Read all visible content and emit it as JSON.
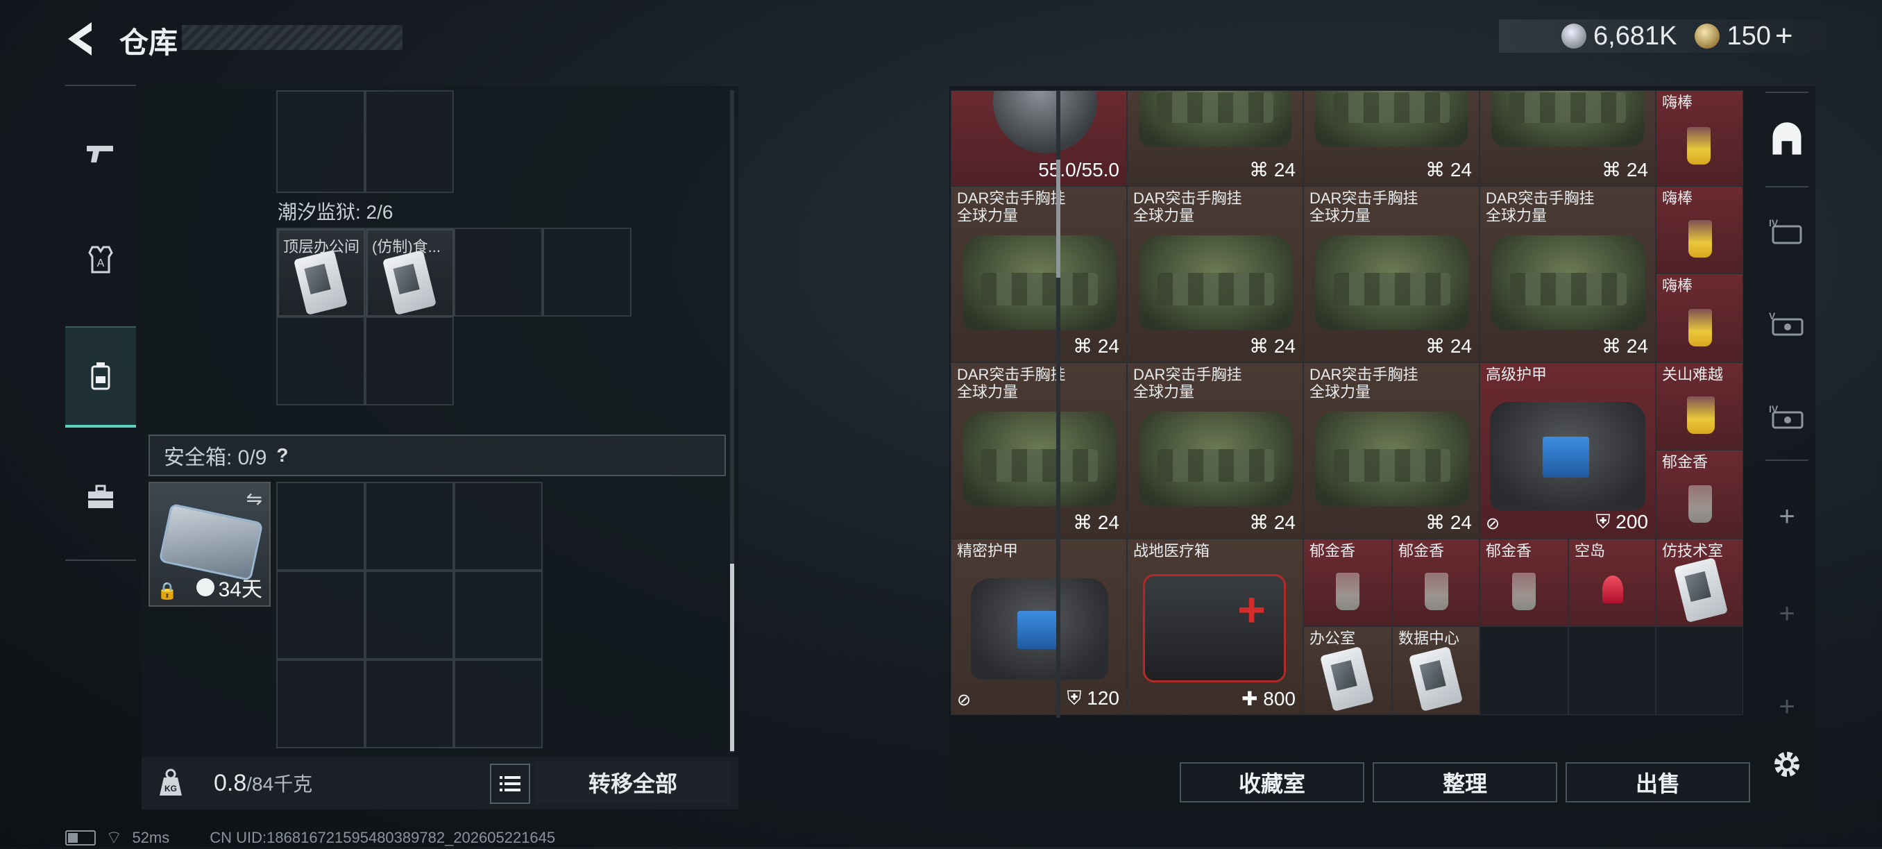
{
  "header": {
    "title": "仓库"
  },
  "currency": {
    "silver": "6,681K",
    "gold": "150"
  },
  "left_nav": [
    {
      "name": "weapons",
      "icon": "pistol-icon"
    },
    {
      "name": "armor",
      "icon": "armor-vest-icon"
    },
    {
      "name": "backpack",
      "icon": "backpack-icon"
    },
    {
      "name": "equipment",
      "icon": "toolbox-icon"
    }
  ],
  "left_panel": {
    "keycard_label": "潮汐监狱: 2/6",
    "keycards": [
      "顶层办公间",
      "(仿制)食..."
    ],
    "safe_box": {
      "label": "安全箱: 0/9",
      "help": "?",
      "duration": "34天"
    },
    "weight": {
      "current": "0.8",
      "max": "/84千克"
    },
    "transfer_all": "转移全部"
  },
  "inventory": {
    "top_row": [
      {
        "value": "55.0/55.0"
      },
      {
        "count": "24"
      },
      {
        "count": "24"
      },
      {
        "count": "24"
      },
      {
        "name": "嗨棒"
      }
    ],
    "rows": [
      {
        "name": "DAR突击手胸挂",
        "sub": "全球力量",
        "count": "24"
      },
      {
        "name": "DAR突击手胸挂",
        "sub": "全球力量",
        "count": "24"
      },
      {
        "name": "DAR突击手胸挂",
        "sub": "全球力量",
        "count": "24"
      },
      {
        "name": "DAR突击手胸挂",
        "sub": "全球力量",
        "count": "24"
      },
      {
        "name": "DAR突击手胸挂",
        "sub": "全球力量",
        "count": "24"
      },
      {
        "name": "DAR突击手胸挂",
        "sub": "全球力量",
        "count": "24"
      },
      {
        "name": "DAR突击手胸挂",
        "sub": "全球力量",
        "count": "24"
      }
    ],
    "drinks_col": [
      "嗨棒",
      "嗨棒",
      "关山难越",
      "郁金香"
    ],
    "armor_high": {
      "name": "高级护甲",
      "durability": "200"
    },
    "armor_precise": {
      "name": "精密护甲",
      "durability": "120"
    },
    "medkit": {
      "name": "战地医疗箱",
      "value": "800"
    },
    "small_items": [
      {
        "name": "郁金香"
      },
      {
        "name": "郁金香"
      },
      {
        "name": "郁金香"
      },
      {
        "name": "空岛"
      },
      {
        "name": "仿技术室"
      },
      {
        "name": "办公室"
      },
      {
        "name": "数据中心"
      }
    ]
  },
  "bottom_buttons": {
    "collection": "收藏室",
    "organize": "整理",
    "sell": "出售"
  },
  "right_nav": [
    "storage-home-icon",
    "folder-IV-icon",
    "weapon-case-V-icon",
    "weapon-case-IV-icon",
    "add-icon",
    "add-icon",
    "add-icon"
  ],
  "status_bar": {
    "ping": "52ms",
    "uid": "CN UID:18681672159548038978​2_202605221645"
  },
  "colors": {
    "accent": "#5fd0c0",
    "item_brown": "#4a3a33",
    "item_red": "#6a2a30"
  }
}
